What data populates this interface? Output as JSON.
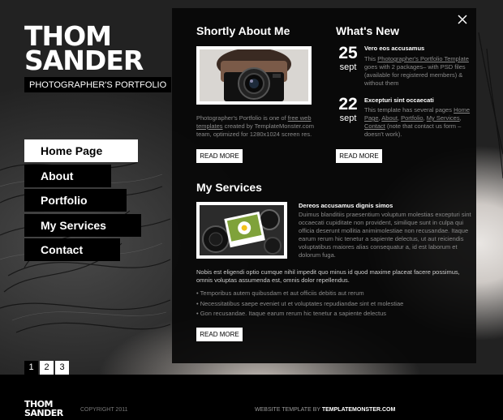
{
  "logo": {
    "name_line1": "THOM",
    "name_line2": "SANDER",
    "tagline": "PHOTOGRAPHER'S PORTFOLIO"
  },
  "menu": {
    "items": [
      {
        "label": "Home Page",
        "active": true
      },
      {
        "label": "About",
        "active": false
      },
      {
        "label": "Portfolio",
        "active": false
      },
      {
        "label": "My Services",
        "active": false
      },
      {
        "label": "Contact",
        "active": false
      }
    ]
  },
  "pager": [
    "1",
    "2",
    "3"
  ],
  "about": {
    "title": "Shortly About Me",
    "text_a": "Photographer's Portfolio is one of ",
    "link1": "free web templates",
    "text_b": " created by TemplateMonster.com team, optimized for 1280x1024 screen res.",
    "button": "READ MORE"
  },
  "news": {
    "title": "What's New",
    "items": [
      {
        "day": "25",
        "month": "sept",
        "headline": "Vero eos accusamus",
        "text_a": "This ",
        "link": "Photographer's Portfolio Template",
        "text_b": " goes with 2 packages– with PSD files (available for registered members) & without them"
      },
      {
        "day": "22",
        "month": "sept",
        "headline": "Excepturi sint occaecati",
        "text_a": "This template has several pages ",
        "links": [
          "Home Page",
          "About",
          "Portfolio",
          "My Services",
          "Contact"
        ],
        "text_b": " (note that contact us form – doesn't work)."
      }
    ],
    "button": "READ MORE"
  },
  "services": {
    "title": "My Services",
    "headline": "Dereos accusamus dignis simos",
    "text": "Duimus blanditiis praesentium voluptum molestias excepturi sint occaecati cupiditate non provident, similique sunt in culpa qui officia deserunt mollitia animimolestiae non recusandae. Itaque earum rerum hic tenetur a sapiente delectus, ut aut reiciendis voluptatibus maiores alias consequatur a, id est laborum et dolorum fuga.",
    "text2": "Nobis est eligendi optio cumque nihil impedit quo minus id quod maxime placeat facere possimus, omnis voluptas assumenda est, omnis dolor repellendus.",
    "bullets": [
      "Temporibus autem quibusdam et aut officiis debitis aut rerum",
      "Necessitatibus saepe eveniet ut et voluptates repudiandae sint et molestiae",
      "Gon recusandae. Itaque earum rerum hic tenetur a sapiente delectus"
    ],
    "button": "READ MORE"
  },
  "footer": {
    "logo_line1": "THOM",
    "logo_line2": "SANDER",
    "copyright": "COPYRIGHT 2011",
    "credit_prefix": "WEBSITE TEMPLATE BY ",
    "credit_site": "TEMPLATEMONSTER.COM"
  },
  "colors": {
    "panel": "#080808",
    "button": "#ffffff",
    "accent_text": "#ffffff",
    "muted_text": "#8a8a8a"
  },
  "icons": {
    "close": "close-icon"
  }
}
